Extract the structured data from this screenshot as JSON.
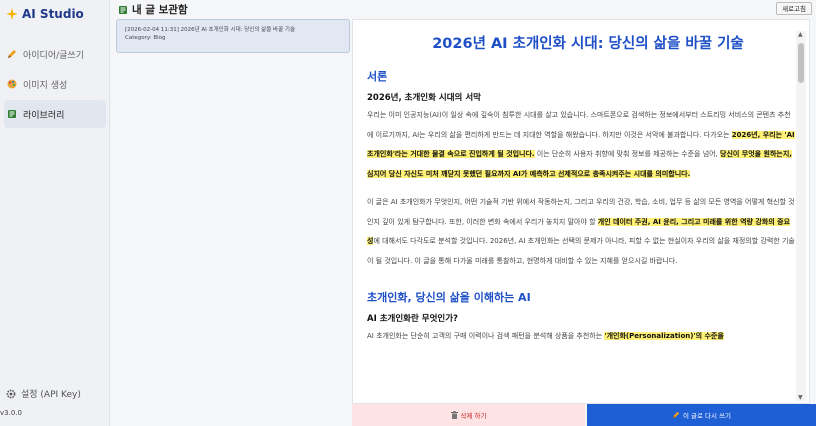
{
  "app": {
    "title": "AI Studio",
    "version": "v3.0.0"
  },
  "sidebar": {
    "items": [
      {
        "label": "아이디어/글쓰기",
        "icon": "pencil-icon"
      },
      {
        "label": "이미지 생성",
        "icon": "palette-icon"
      },
      {
        "label": "라이브러리",
        "icon": "book-icon"
      }
    ],
    "settings_label": "설정 (API Key)"
  },
  "topbar": {
    "title": "내 글 보관함",
    "refresh_label": "새로고침"
  },
  "list": {
    "items": [
      {
        "title": "[2026-02-04 11:31] 2026년 AI 초개인화 시대: 당신의 삶을 바꿀 기술",
        "category": "Category: Blog"
      }
    ]
  },
  "article": {
    "title": "2026년 AI 초개인화 시대: 당신의 삶을 바꿀 기술",
    "section1": {
      "heading": "서론",
      "sub": "2026년, 초개인화 시대의 서막",
      "p1_a": "우리는 이미 인공지능(AI)이 일상 속에 깊숙이 침투한 시대를 살고 있습니다. 스마트폰으로 검색하는 정보에서부터 스트리밍 서비스의 콘텐츠 추천에 이르기까지, AI는 우리의 삶을 편리하게 만드는 데 지대한 역할을 해왔습니다. 하지만 이것은 서막에 불과합니다. 다가오는 ",
      "p1_hl1": "2026년, 우리는 'AI 초개인화'라는 거대한 물결 속으로 진입하게 될 것입니다.",
      "p1_b": " 이는 단순히 사용자 취향에 맞춰 정보를 제공하는 수준을 넘어, ",
      "p1_hl2": "당신이 무엇을 원하는지, 심지어 당신 자신도 미처 깨닫지 못했던 필요까지 AI가 예측하고 선제적으로 충족시켜주는 시대를 의미합니다.",
      "p2_a": "이 글은 AI 초개인화가 무엇인지, 어떤 기술적 기반 위에서 작동하는지, 그리고 우리의 건강, 학습, 소비, 업무 등 삶의 모든 영역을 어떻게 혁신할 것인지 깊이 있게 탐구합니다. 또한, 이러한 변화 속에서 우리가 놓치지 말아야 할 ",
      "p2_hl": "개인 데이터 주권, AI 윤리, 그리고 미래를 위한 역량 강화의 중요성",
      "p2_b": "에 대해서도 다각도로 분석할 것입니다. 2026년, AI 초개인화는 선택의 문제가 아니라, 피할 수 없는 현실이자 우리의 삶을 재정의할 강력한 기술이 될 것입니다. 이 글을 통해 다가올 미래를 통찰하고, 현명하게 대비할 수 있는 지혜를 얻으시길 바랍니다."
    },
    "section2": {
      "heading": "초개인화, 당신의 삶을 이해하는 AI",
      "sub": "AI 초개인화란 무엇인가?",
      "p1_a": "AI 초개인화는 단순히 고객의 구매 이력이나 검색 패턴을 분석해 상품을 추천하는 ",
      "p1_hl": "'개인화(Personalization)'의 수준을"
    }
  },
  "actions": {
    "delete_label": "삭제 하기",
    "rewrite_label": "이 글로 다시 쓰기"
  },
  "colors": {
    "accent": "#1e4fc7",
    "highlight": "#fff176",
    "danger_bg": "#fde3e3",
    "primary": "#1f5fd6"
  }
}
